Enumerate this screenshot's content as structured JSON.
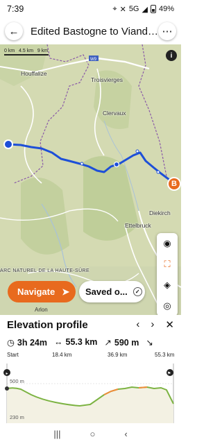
{
  "status_bar": {
    "time": "7:39",
    "network": "5G",
    "battery": "49%"
  },
  "header": {
    "back_icon": "arrow-left-icon",
    "title": "Edited Bastogne to Viand…",
    "more_icon": "more-dots-icon"
  },
  "map": {
    "scale": {
      "labels": [
        "0 km",
        "4.5 km",
        "9 km"
      ]
    },
    "places": [
      "Houffalize",
      "Troisvierges",
      "Clervaux",
      "Diekirch",
      "Ettelbruck",
      "ARC NATUREL DE LA HAUTE-SÛRE",
      "Arlon"
    ],
    "road_label": "W9",
    "destination_marker": "B",
    "tools": [
      "eye-icon",
      "frame-select-icon",
      "layers-icon",
      "locate-icon"
    ],
    "navigate_label": "Navigate",
    "saved_label": "Saved o..."
  },
  "elevation": {
    "title": "Elevation profile",
    "duration": "3h 24m",
    "distance": "55.3 km",
    "ascent": "590 m",
    "x_labels": [
      "Start",
      "18.4 km",
      "36.9 km",
      "55.3 km"
    ],
    "y_labels": [
      "500 m",
      "230 m"
    ]
  },
  "colors": {
    "accent": "#e86a1e",
    "route": "#1d4fd8",
    "profile": "#7cb342"
  }
}
